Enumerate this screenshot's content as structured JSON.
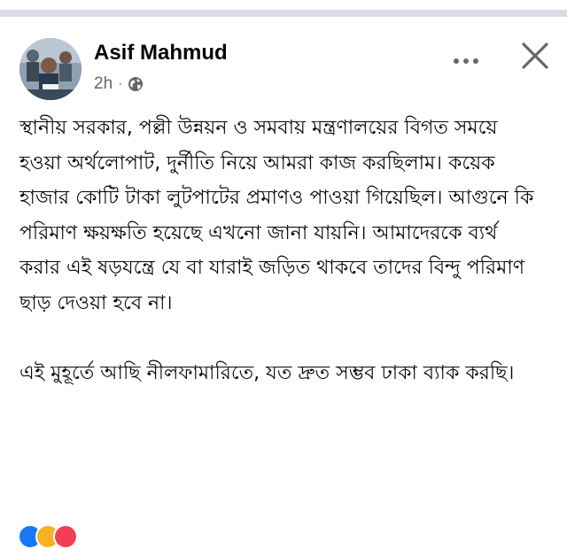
{
  "post": {
    "author_name": "Asif Mahmud",
    "timestamp": "2h",
    "separator": "·",
    "audience_icon": "globe-icon",
    "more_icon": "more-horizontal-icon",
    "close_icon": "close-icon",
    "paragraphs": [
      "স্থানীয় সরকার, পল্লী উন্নয়ন ও সমবায় মন্ত্রণালয়ের বিগত সময়ে হওয়া অর্থলোপাট, দুর্নীতি নিয়ে আমরা কাজ করছিলাম। কয়েক হাজার কোটি টাকা লুটপাটের প্রমাণও পাওয়া গিয়েছিল। আগুনে কি পরিমাণ ক্ষয়ক্ষতি হয়েছে এখনো জানা যায়নি। আমাদেরকে ব্যর্থ করার এই ষড়যন্ত্রে যে বা যারাই জড়িত থাকবে তাদের বিন্দু পরিমাণ ছাড় দেওয়া হবে না।",
      "এই মুহূর্তে আছি নীলফামারিতে, যত দ্রুত সম্ভব ঢাকা ব্যাক করছি।"
    ]
  },
  "colors": {
    "text_primary": "#050505",
    "text_secondary": "#65676b",
    "divider": "#dadde1",
    "reaction_like": "#1877f2",
    "reaction_haha": "#f7b125",
    "reaction_love": "#f33e58"
  }
}
